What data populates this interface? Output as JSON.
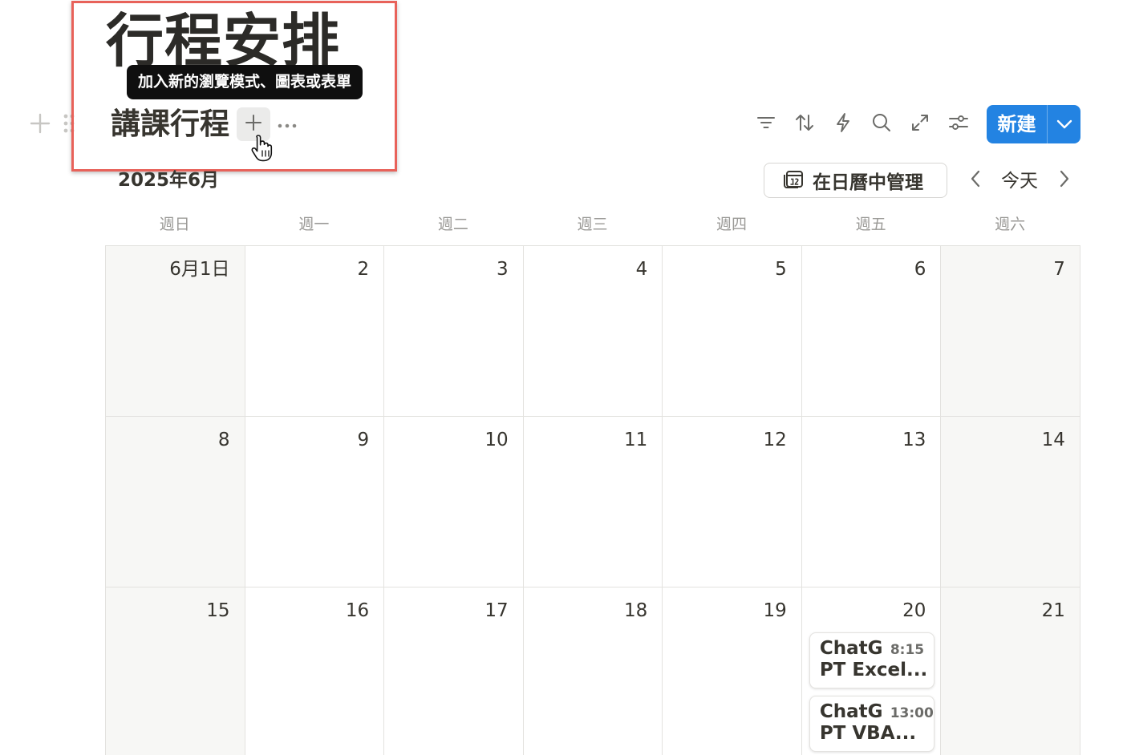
{
  "page": {
    "title": "行程安排"
  },
  "tooltip": {
    "text": "加入新的瀏覽模式、圖表或表單"
  },
  "view": {
    "name": "講課行程"
  },
  "toolbar": {
    "icons": [
      "filter-icon",
      "sort-icon",
      "automation-icon",
      "search-icon",
      "expand-icon",
      "settings-icon"
    ],
    "new_label": "新建"
  },
  "calendar": {
    "month_label": "2025年6月",
    "manage_label": "在日曆中管理",
    "today_label": "今天",
    "weekdays": [
      "週日",
      "週一",
      "週二",
      "週三",
      "週四",
      "週五",
      "週六"
    ],
    "weeks": [
      [
        "6月1日",
        "2",
        "3",
        "4",
        "5",
        "6",
        "7"
      ],
      [
        "8",
        "9",
        "10",
        "11",
        "12",
        "13",
        "14"
      ],
      [
        "15",
        "16",
        "17",
        "18",
        "19",
        "20",
        "21"
      ]
    ],
    "events": [
      {
        "title_line1": "ChatG",
        "title_line2": "PT Excel...",
        "time": "8:15"
      },
      {
        "title_line1": "ChatG",
        "title_line2": "PT VBA...",
        "time": "13:00"
      }
    ]
  },
  "colors": {
    "accent": "#2383e2",
    "highlight": "#e8625a",
    "weekend_bg": "#f7f7f5"
  }
}
